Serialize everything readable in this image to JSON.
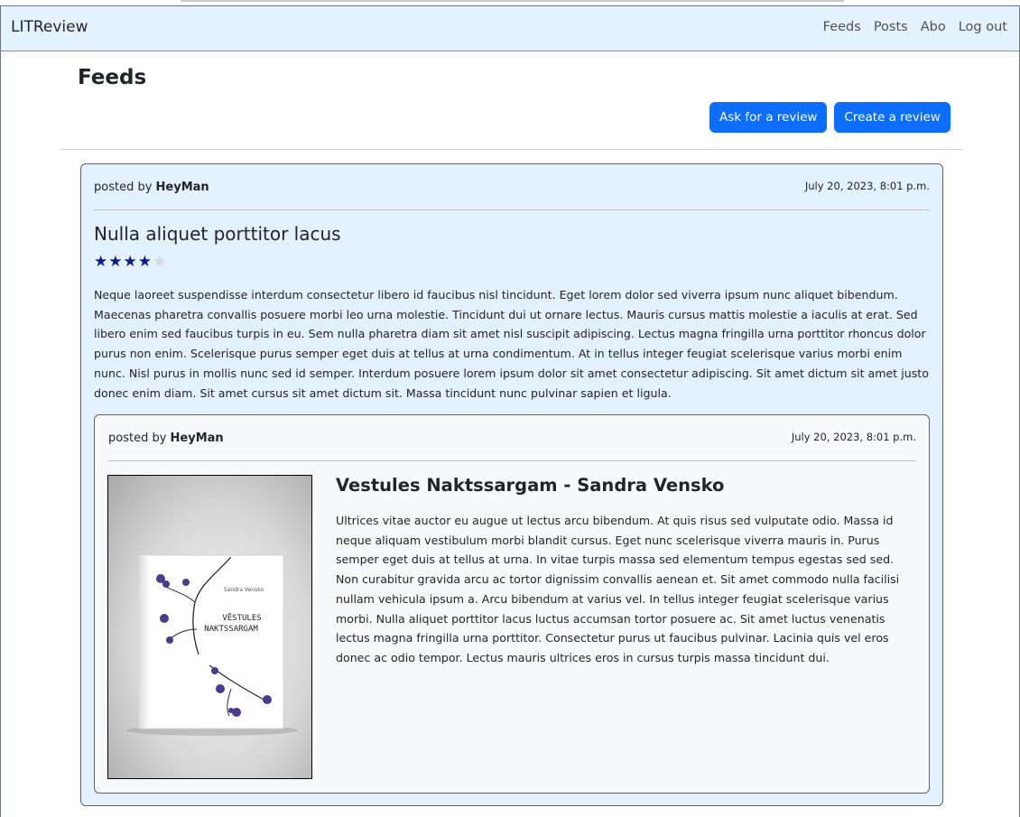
{
  "navbar": {
    "brand": "LITReview",
    "links": [
      "Feeds",
      "Posts",
      "Abo",
      "Log out"
    ]
  },
  "page": {
    "title": "Feeds",
    "ask_review_label": "Ask for a review",
    "create_review_label": "Create a review"
  },
  "review": {
    "posted_by_prefix": "posted by",
    "author": "HeyMan",
    "date": "July 20, 2023, 8:01 p.m.",
    "title": "Nulla aliquet porttitor lacus",
    "rating": 4,
    "rating_max": 5,
    "body": "Neque laoreet suspendisse interdum consectetur libero id faucibus nisl tincidunt. Eget lorem dolor sed viverra ipsum nunc aliquet bibendum. Maecenas pharetra convallis posuere morbi leo urna molestie. Tincidunt dui ut ornare lectus. Mauris cursus mattis molestie a iaculis at erat. Sed libero enim sed faucibus turpis in eu. Sem nulla pharetra diam sit amet nisl suscipit adipiscing. Lectus magna fringilla urna porttitor rhoncus dolor purus non enim. Scelerisque purus semper eget duis at tellus at urna condimentum. At in tellus integer feugiat scelerisque varius morbi enim nunc. Nisl purus in mollis nunc sed id semper. Interdum posuere lorem ipsum dolor sit amet consectetur adipiscing. Sit amet dictum sit amet justo donec enim diam. Sit amet cursus sit amet dictum sit. Massa tincidunt nunc pulvinar sapien et ligula."
  },
  "ticket": {
    "posted_by_prefix": "posted by",
    "author": "HeyMan",
    "date": "July 20, 2023, 8:01 p.m.",
    "title": "Vestules Naktssargam - Sandra Vensko",
    "body": "Ultrices vitae auctor eu augue ut lectus arcu bibendum. At quis risus sed vulputate odio. Massa id neque aliquam vestibulum morbi blandit cursus. Eget nunc scelerisque viverra mauris in. Purus semper eget duis at tellus at urna. In vitae turpis massa sed elementum tempus egestas sed sed. Non curabitur gravida arcu ac tortor dignissim convallis aenean et. Sit amet commodo nulla facilisi nullam vehicula ipsum a. Arcu bibendum at varius vel. In tellus integer feugiat scelerisque varius morbi. Nulla aliquet porttitor lacus luctus accumsan tortor posuere ac. Sit amet luctus venenatis lectus magna fringilla urna porttitor. Consectetur purus ut faucibus pulvinar. Lacinia quis vel eros donec ac odio tempor. Lectus mauris ultrices eros in cursus turpis massa tincidunt dui.",
    "cover": {
      "author_text": "Sandra Vensko",
      "title_line1": "VĒSTULES",
      "title_line2": "NAKTSSARGAM"
    }
  },
  "colors": {
    "navbar_bg": "#e3f2fd",
    "primary": "#0d6efd",
    "star_on": "#0b1a8c",
    "star_off": "#d6d9dd"
  }
}
